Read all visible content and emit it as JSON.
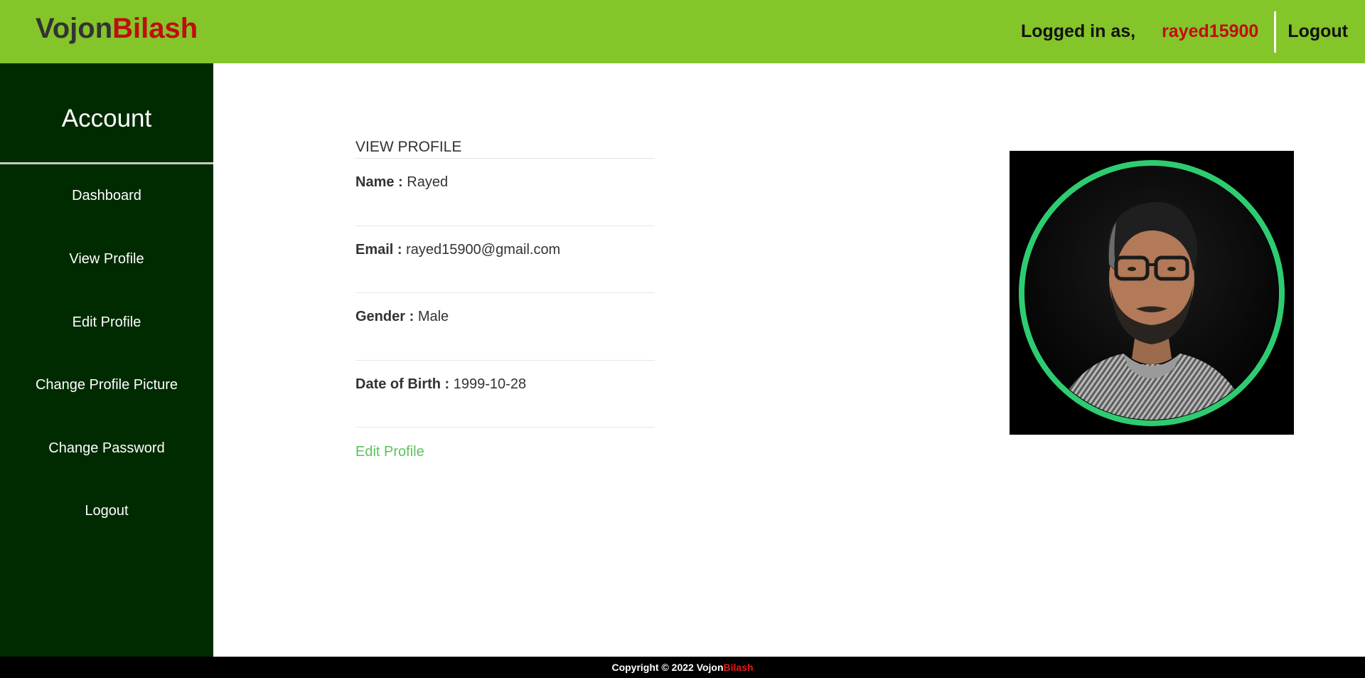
{
  "header": {
    "brand_part1": "Vojon",
    "brand_part2": "Bilash",
    "logged_in_label": "Logged in as,",
    "username": "rayed15900",
    "logout_label": "Logout"
  },
  "sidebar": {
    "title": "Account",
    "items": [
      {
        "label": "Dashboard"
      },
      {
        "label": "View Profile"
      },
      {
        "label": "Edit Profile"
      },
      {
        "label": "Change Profile Picture"
      },
      {
        "label": "Change Password"
      },
      {
        "label": "Logout"
      }
    ]
  },
  "profile": {
    "section_title": "VIEW PROFILE",
    "fields": [
      {
        "label": "Name :",
        "value": "Rayed"
      },
      {
        "label": "Email :",
        "value": "rayed15900@gmail.com"
      },
      {
        "label": "Gender :",
        "value": "Male"
      },
      {
        "label": "Date of Birth :",
        "value": "1999-10-28"
      }
    ],
    "edit_link": "Edit Profile"
  },
  "footer": {
    "prefix": "Copyright © 2022 ",
    "brand_part1": "Vojon",
    "brand_part2": "Bilash"
  },
  "colors": {
    "header_bg": "#84c52a",
    "sidebar_bg": "#002b00",
    "brand_red": "#c00d0d",
    "link_green": "#5cc15c",
    "avatar_ring": "#2ecc71"
  }
}
